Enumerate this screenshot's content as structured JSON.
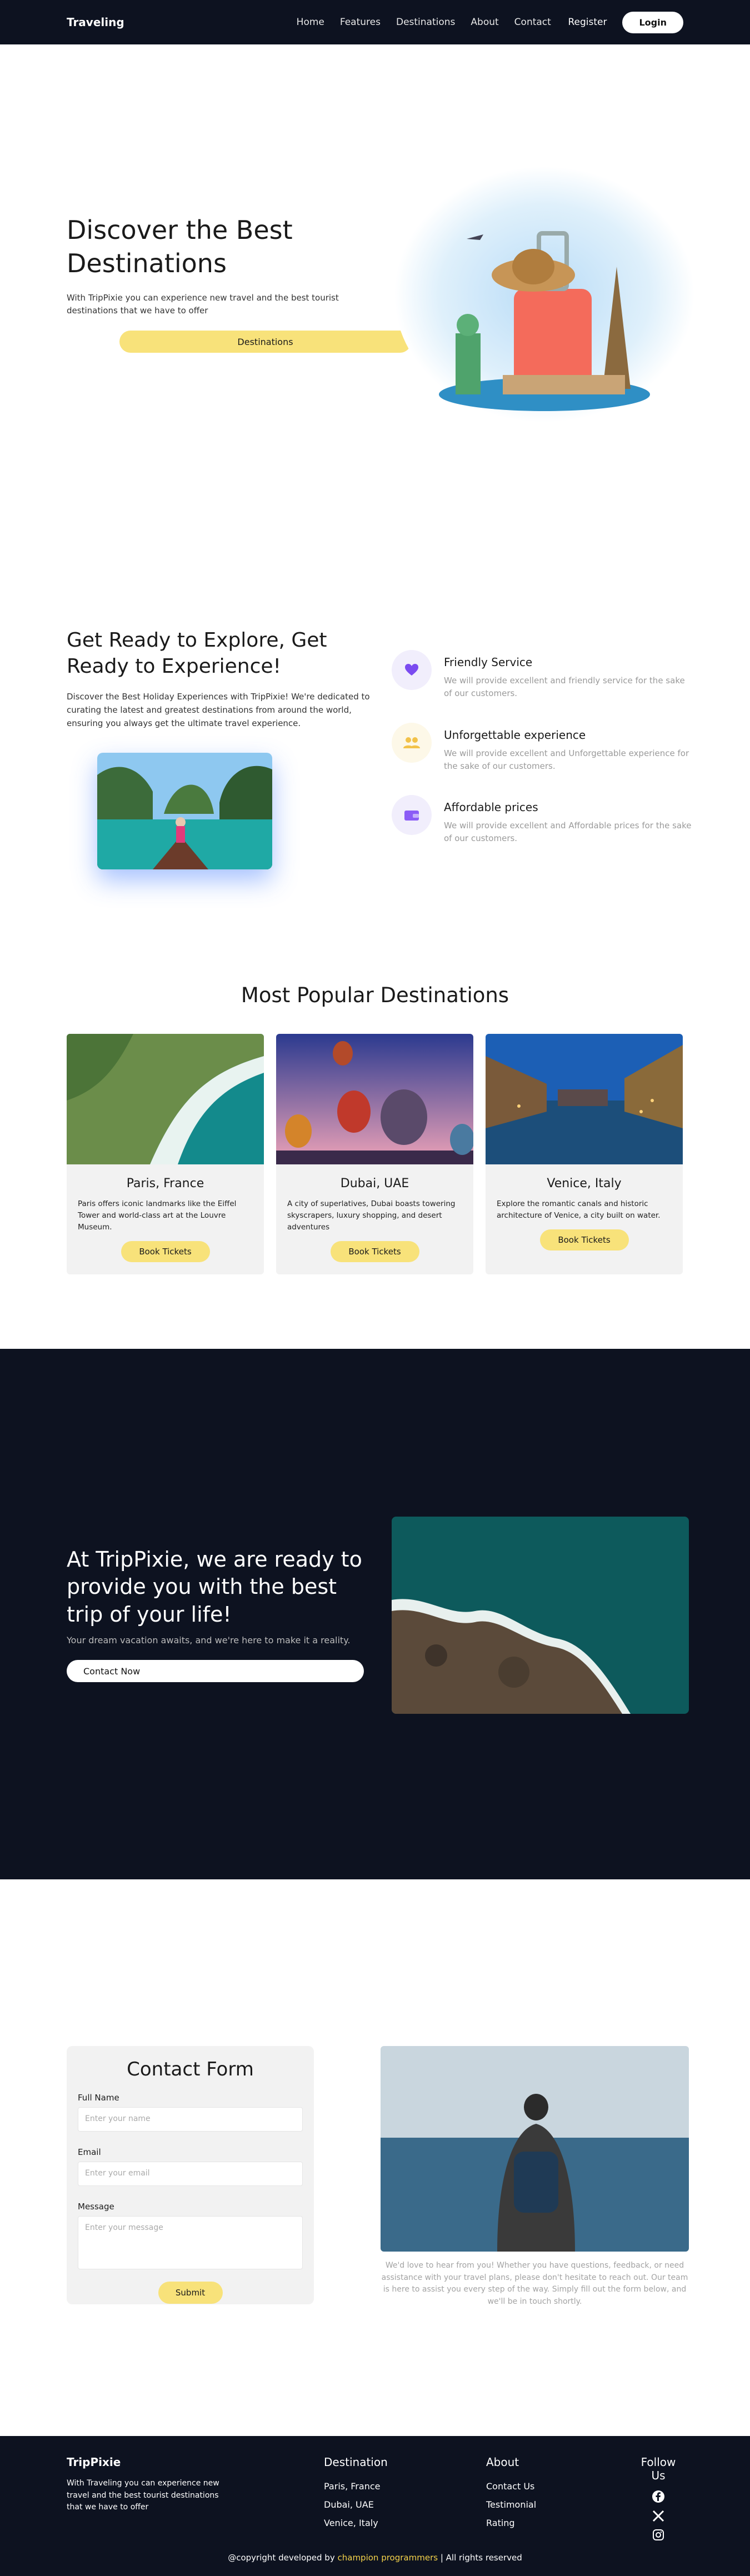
{
  "nav": {
    "brand": "Traveling",
    "links": [
      "Home",
      "Features",
      "Destinations",
      "About",
      "Contact"
    ],
    "register": "Register",
    "login": "Login"
  },
  "hero": {
    "title": "Discover the Best Destinations",
    "text": "With TripPixie you can experience new travel and the best tourist destinations that we have to offer",
    "cta": "Destinations"
  },
  "features": {
    "title": "Get Ready to Explore, Get Ready to Experience!",
    "intro": "Discover the Best Holiday Experiences with TripPixie! We're dedicated to curating the latest and greatest destinations from around the world, ensuring you always get the ultimate travel experience.",
    "items": [
      {
        "title": "Friendly Service",
        "text": "We will provide excellent and friendly service for the sake of our customers.",
        "icon": "heart-icon",
        "color": "#7b4bf0"
      },
      {
        "title": "Unforgettable experience",
        "text": "We will provide excellent and Unforgettable experience for the sake of our customers.",
        "icon": "users-icon",
        "color": "#f2c24a"
      },
      {
        "title": "Affordable prices",
        "text": "We will provide excellent and Affordable prices for the sake of our customers.",
        "icon": "wallet-icon",
        "color": "#8b5cf6"
      }
    ]
  },
  "destinations": {
    "title": "Most Popular Destinations",
    "cards": [
      {
        "name": "Paris, France",
        "text": "Paris offers iconic landmarks like the Eiffel Tower and world-class art at the Louvre Museum.",
        "button": "Book Tickets"
      },
      {
        "name": "Dubai, UAE",
        "text": "A city of superlatives, Dubai boasts towering skyscrapers, luxury shopping, and desert adventures",
        "button": "Book Tickets"
      },
      {
        "name": "Venice, Italy",
        "text": "Explore the romantic canals and historic architecture of Venice, a city built on water.",
        "button": "Book Tickets"
      }
    ]
  },
  "band": {
    "title": "At TripPixie, we are ready to provide you with the best trip of your life!",
    "text": "Your dream vacation awaits, and we're here to make it a reality.",
    "cta": "Contact Now"
  },
  "contact": {
    "title": "Contact Form",
    "name_label": "Full Name",
    "name_placeholder": "Enter your name",
    "email_label": "Email",
    "email_placeholder": "Enter your email",
    "message_label": "Message",
    "message_placeholder": "Enter your message",
    "submit": "Submit",
    "note": "We'd love to hear from you! Whether you have questions, feedback, or need assistance with your travel plans, please don't hesitate to reach out. Our team is here to assist you every step of the way. Simply fill out the form below, and we'll be in touch shortly."
  },
  "footer": {
    "brand": "TripPixie",
    "brand_text": "With Traveling you can experience new travel and the best tourist destinations that we have to offer",
    "destination_title": "Destination",
    "destinations": [
      "Paris, France",
      "Dubai, UAE",
      "Venice, Italy"
    ],
    "about_title": "About",
    "about": [
      "Contact Us",
      "Testimonial",
      "Rating"
    ],
    "follow_title": "Follow Us",
    "copy_pre": "@copyright developed by",
    "copy_link": "champion programmers",
    "copy_post": "| All rights reserved"
  }
}
